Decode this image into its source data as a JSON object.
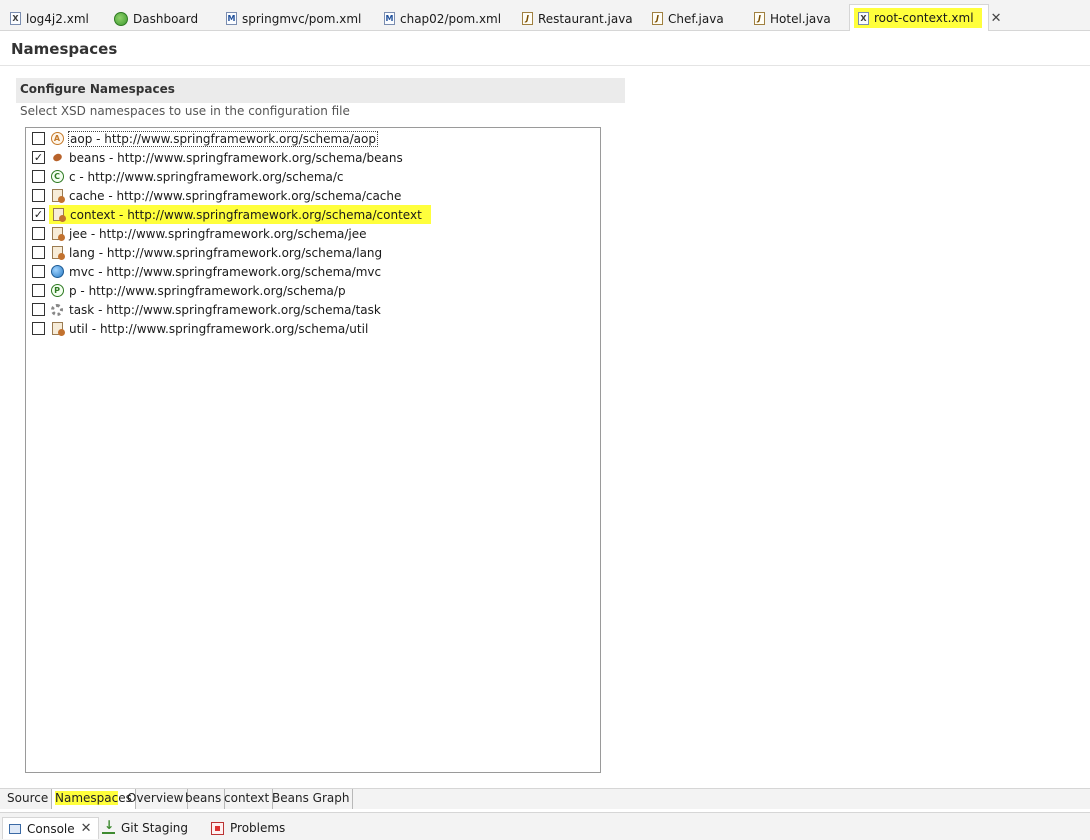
{
  "editor_tabs": [
    {
      "label": "log4j2.xml",
      "icon": "xml-file-icon",
      "active": false
    },
    {
      "label": "Dashboard",
      "icon": "spring-icon",
      "active": false
    },
    {
      "label": "springmvc/pom.xml",
      "icon": "maven-pom-icon",
      "active": false
    },
    {
      "label": "chap02/pom.xml",
      "icon": "maven-pom-icon",
      "active": false
    },
    {
      "label": "Restaurant.java",
      "icon": "java-file-icon",
      "active": false
    },
    {
      "label": "Chef.java",
      "icon": "java-file-icon",
      "active": false
    },
    {
      "label": "Hotel.java",
      "icon": "java-file-icon",
      "active": false
    },
    {
      "label": "root-context.xml",
      "icon": "xml-file-icon",
      "active": true
    }
  ],
  "page": {
    "title": "Namespaces"
  },
  "section": {
    "title": "Configure Namespaces",
    "description": "Select XSD namespaces to use in the configuration file"
  },
  "namespaces": [
    {
      "label": "aop - http://www.springframework.org/schema/aop",
      "checked": false,
      "icon": "aop-icon"
    },
    {
      "label": "beans - http://www.springframework.org/schema/beans",
      "checked": true,
      "icon": "bean-icon"
    },
    {
      "label": "c - http://www.springframework.org/schema/c",
      "checked": false,
      "icon": "c-namespace-icon"
    },
    {
      "label": "cache - http://www.springframework.org/schema/cache",
      "checked": false,
      "icon": "cache-icon"
    },
    {
      "label": "context - http://www.springframework.org/schema/context",
      "checked": true,
      "icon": "context-icon"
    },
    {
      "label": "jee - http://www.springframework.org/schema/jee",
      "checked": false,
      "icon": "jee-icon"
    },
    {
      "label": "lang - http://www.springframework.org/schema/lang",
      "checked": false,
      "icon": "lang-icon"
    },
    {
      "label": "mvc - http://www.springframework.org/schema/mvc",
      "checked": false,
      "icon": "mvc-icon"
    },
    {
      "label": "p - http://www.springframework.org/schema/p",
      "checked": false,
      "icon": "p-namespace-icon"
    },
    {
      "label": "task - http://www.springframework.org/schema/task",
      "checked": false,
      "icon": "task-icon"
    },
    {
      "label": "util - http://www.springframework.org/schema/util",
      "checked": false,
      "icon": "util-icon"
    }
  ],
  "page_tabs": [
    {
      "label": "Source",
      "active": false
    },
    {
      "label_highlighted": "Namespac",
      "label_rest": "es",
      "active": true
    },
    {
      "label": "Overview",
      "active": false
    },
    {
      "label": "beans",
      "active": false
    },
    {
      "label": "context",
      "active": false
    },
    {
      "label": "Beans Graph",
      "active": false
    }
  ],
  "view_tabs": [
    {
      "label": "Console",
      "icon": "console-icon",
      "active": true
    },
    {
      "label": "Git Staging",
      "icon": "git-staging-icon",
      "active": false
    },
    {
      "label": "Problems",
      "icon": "problems-icon",
      "active": false
    }
  ],
  "colors": {
    "highlight": "#ffff3c",
    "tab_strip": "#f3f3f3",
    "section_header": "#ebebeb"
  }
}
